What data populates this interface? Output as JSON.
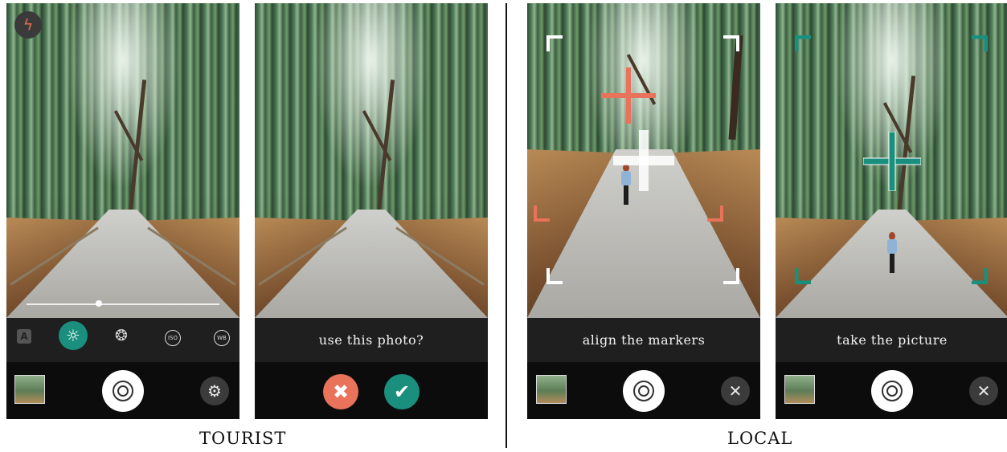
{
  "screens": [
    {
      "id": "tourist-camera",
      "mode": "camera",
      "flash_icon": "no-flash-icon",
      "exposure_slider_fraction": 0.38,
      "tool_icons": [
        "auto-mode-icon",
        "brightness-icon",
        "aperture-icon",
        "iso-icon",
        "wb-icon"
      ],
      "tool_labels": {
        "auto": "A",
        "iso": "ISO",
        "wb": "WB"
      },
      "selected_tool": "brightness-icon",
      "settings_icon": "gear-icon"
    },
    {
      "id": "tourist-confirm",
      "mode": "confirm",
      "prompt": "use this photo?",
      "reject_icon": "✖",
      "accept_icon": "✔"
    },
    {
      "id": "local-align",
      "mode": "align",
      "prompt": "align the markers",
      "close_icon": "✕",
      "marker_color": "#e8725a"
    },
    {
      "id": "local-take",
      "mode": "take",
      "prompt": "take the picture",
      "close_icon": "✕",
      "marker_color": "#1a8f7e"
    }
  ],
  "captions": {
    "left": "TOURIST",
    "right": "LOCAL"
  },
  "colors": {
    "accent_green": "#1a8f7e",
    "accent_orange": "#e8725a",
    "bar": "#1f1f1f",
    "bottom": "#0c0c0c"
  }
}
